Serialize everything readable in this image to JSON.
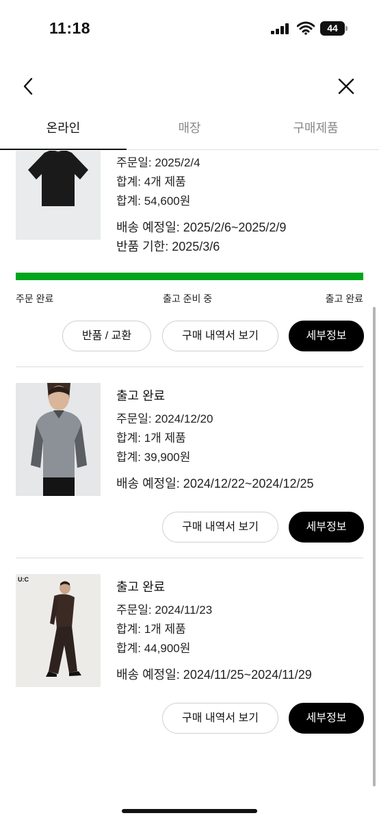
{
  "status_bar": {
    "time": "11:18",
    "battery": "44"
  },
  "tabs": [
    {
      "label": "온라인",
      "active": true
    },
    {
      "label": "매장",
      "active": false
    },
    {
      "label": "구매제품",
      "active": false
    }
  ],
  "orders": [
    {
      "order_date": "주문일: 2025/2/4",
      "item_count": "합계: 4개 제품",
      "total": "합계: 54,600원",
      "delivery": "배송 예정일: 2025/2/6~2025/2/9",
      "return_deadline": "반품 기한: 2025/3/6",
      "progress": {
        "fraction": 1.0,
        "color": "#00a51c",
        "steps": [
          "주문 완료",
          "출고 준비 중",
          "출고 완료"
        ]
      },
      "buttons": {
        "return_exchange": "반품 / 교환",
        "receipt": "구매 내역서 보기",
        "details": "세부정보"
      }
    },
    {
      "status": "출고 완료",
      "order_date": "주문일: 2024/12/20",
      "item_count": "합계: 1개 제품",
      "total": "합계: 39,900원",
      "delivery": "배송 예정일: 2024/12/22~2024/12/25",
      "buttons": {
        "receipt": "구매 내역서 보기",
        "details": "세부정보"
      }
    },
    {
      "status": "출고 완료",
      "thumb_logo": "U:C",
      "order_date": "주문일: 2024/11/23",
      "item_count": "합계: 1개 제품",
      "total": "합계: 44,900원",
      "delivery": "배송 예정일: 2024/11/25~2024/11/29",
      "buttons": {
        "receipt": "구매 내역서 보기",
        "details": "세부정보"
      }
    }
  ],
  "icons": {
    "back": "chevron-left-icon",
    "close": "close-icon",
    "signal": "cellular-signal-icon",
    "wifi": "wifi-icon",
    "battery": "battery-icon"
  }
}
